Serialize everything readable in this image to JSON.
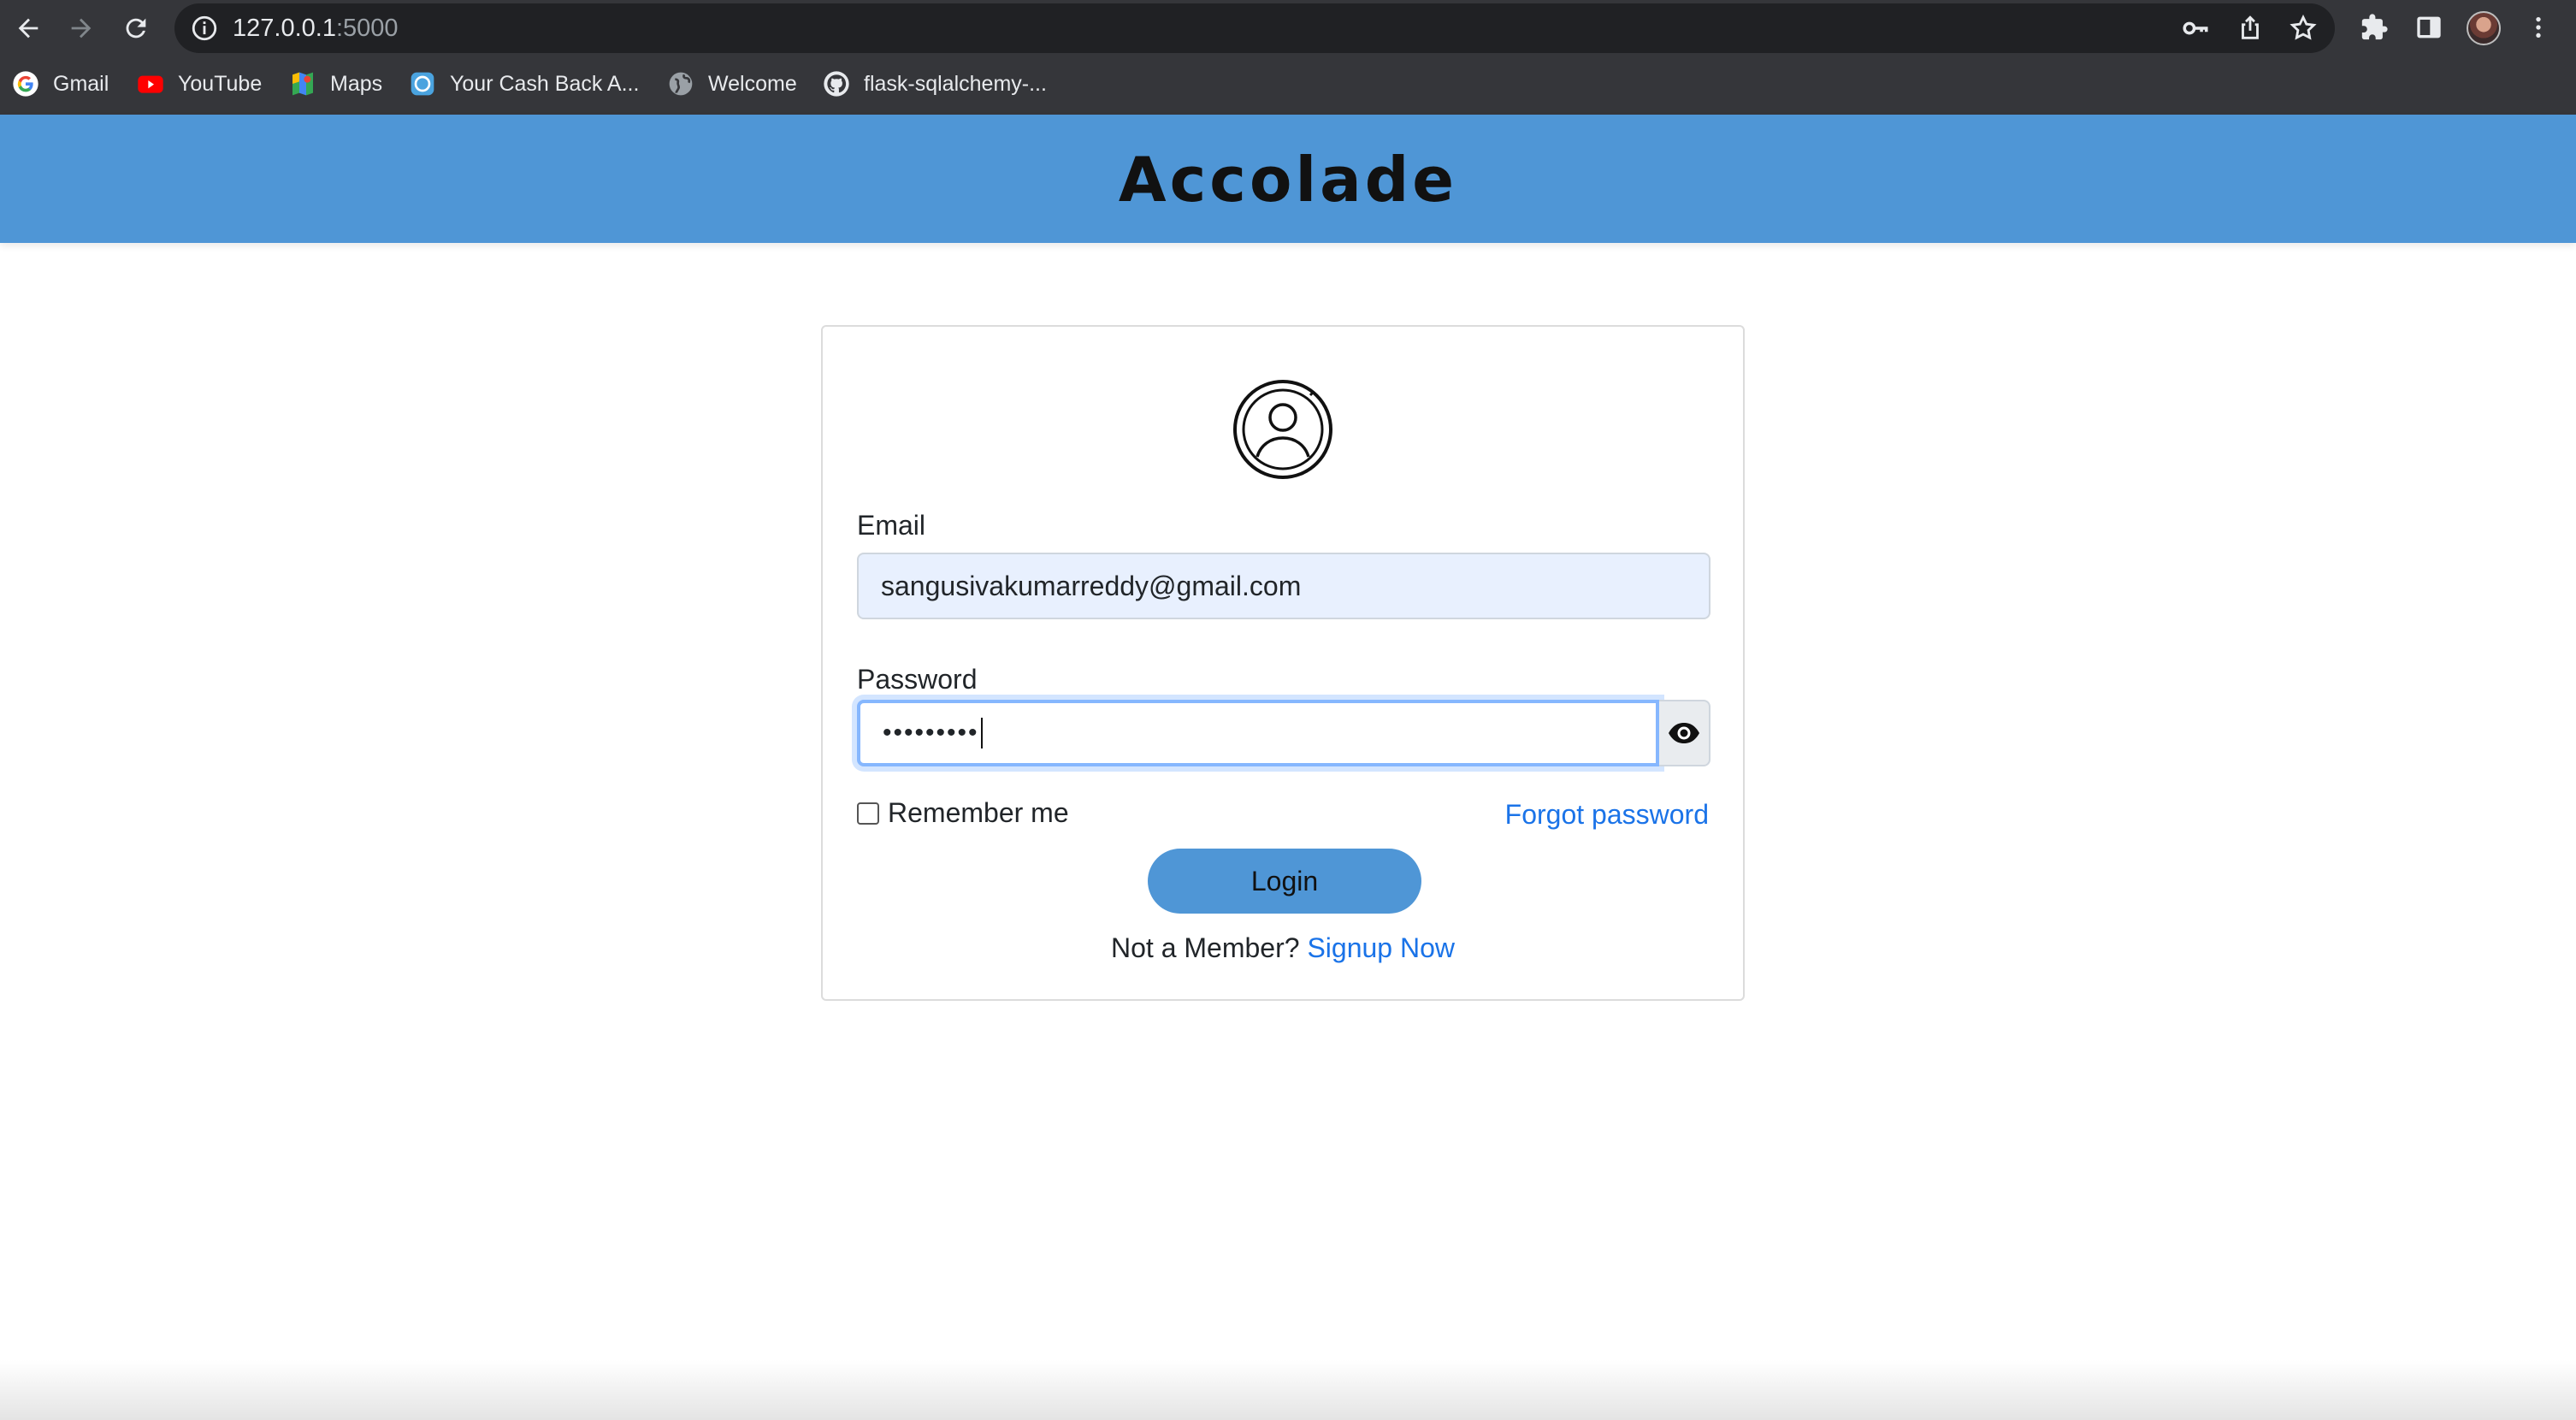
{
  "browser": {
    "url_host": "127.0.0.1",
    "url_port": ":5000",
    "icons": [
      "back-arrow-icon",
      "forward-arrow-icon",
      "reload-icon",
      "site-info-icon",
      "key-icon",
      "share-icon",
      "star-icon",
      "extensions-icon",
      "side-panel-icon",
      "profile-avatar",
      "more-menu-icon"
    ],
    "bookmarks": [
      {
        "label": "Gmail",
        "icon": "google-icon"
      },
      {
        "label": "YouTube",
        "icon": "youtube-icon"
      },
      {
        "label": "Maps",
        "icon": "maps-icon"
      },
      {
        "label": "Your Cash Back A...",
        "icon": "cashback-icon"
      },
      {
        "label": "Welcome",
        "icon": "globe-icon"
      },
      {
        "label": "flask-sqlalchemy-...",
        "icon": "github-icon"
      }
    ]
  },
  "header": {
    "brand": "Accolade",
    "bg_color": "#4f96d6"
  },
  "login": {
    "email_label": "Email",
    "email_value": "sangusivakumarreddy@gmail.com",
    "password_label": "Password",
    "password_masked": "•••••••••",
    "remember_label": "Remember me",
    "remember_checked": false,
    "forgot_label": "Forgot password",
    "login_button": "Login",
    "not_member": "Not a Member?",
    "signup_link": "Signup Now",
    "link_color": "#1a73e8"
  }
}
